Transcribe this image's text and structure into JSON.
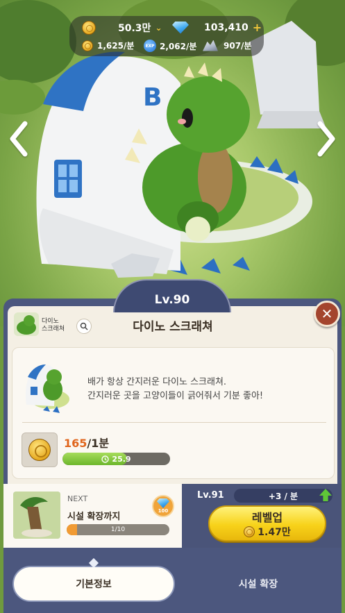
{
  "resources": {
    "coins": "50.3만",
    "gems": "103,410",
    "coin_rate": "1,625/분",
    "exp_rate": "2,062/분",
    "stone_rate": "907/분",
    "exp_icon_text": "EXP"
  },
  "facility": {
    "level_label": "Lv.90",
    "thumb_name": "다이노\n스크래쳐",
    "title": "다이노 스크래쳐",
    "description_line1": "배가 항상 간지러운 다이노 스크래쳐.",
    "description_line2": "간지러운 곳을 고양이들이 긁어줘서 기분 좋아!",
    "production_value": "165",
    "production_unit": "/1분",
    "timer_text": "25.9",
    "timer_progress": 0.6
  },
  "next": {
    "label": "NEXT",
    "title": "시설 확장까지",
    "gem_reward": "100",
    "progress_text": "1/10",
    "progress": 0.1
  },
  "level_up": {
    "next_level": "Lv.91",
    "rate_bonus": "+3 / 분",
    "button_label": "레벨업",
    "cost": "1.47만"
  },
  "tabs": {
    "basic_info": "기본정보",
    "expand": "시설 확장"
  },
  "colors": {
    "panel": "#4c577e",
    "accent_yellow": "#f7d21a",
    "timer_green": "#6cb62b",
    "progress_orange": "#f19b33",
    "close_red": "#a4452e"
  },
  "icons": {
    "coin": "coin-icon",
    "gem": "gem-icon",
    "exp": "exp-icon",
    "stone": "stone-icon",
    "close": "close-icon",
    "search": "search-icon",
    "clock": "clock-icon",
    "arrow_up": "arrow-up-icon"
  }
}
